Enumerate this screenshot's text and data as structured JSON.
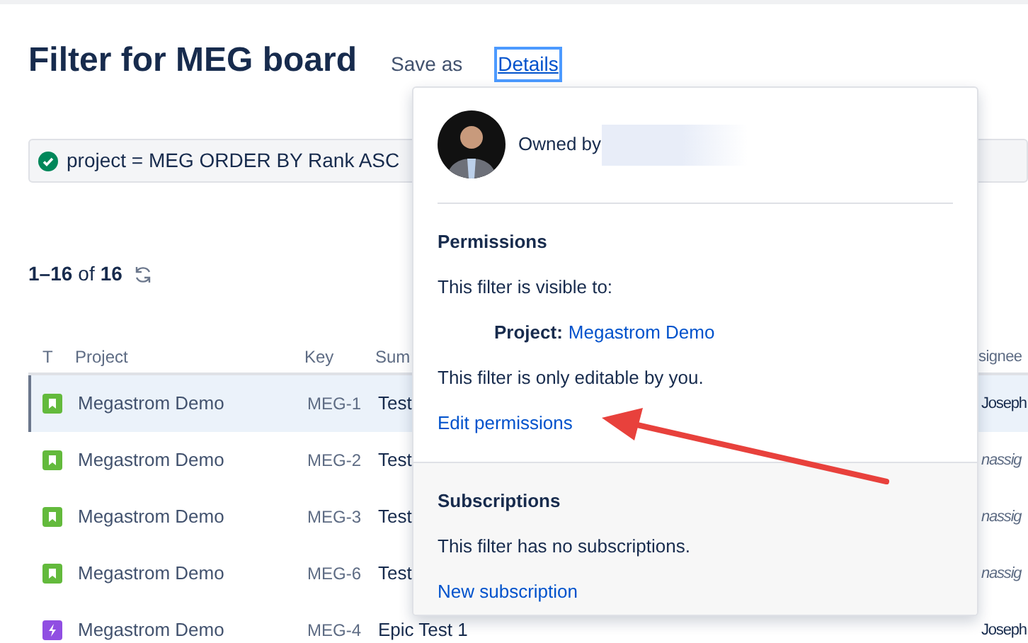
{
  "header": {
    "title": "Filter for MEG board",
    "save_as": "Save as",
    "details": {
      "label": "Details",
      "selected": true
    }
  },
  "query": {
    "text": "project = MEG ORDER BY Rank ASC",
    "valid": true
  },
  "count": {
    "range": "1–16",
    "of": "of",
    "total": "16"
  },
  "table": {
    "columns": [
      "T",
      "Project",
      "Key",
      "Sum",
      "signee"
    ],
    "rows": [
      {
        "kind": "story",
        "project": "Megastrom Demo",
        "key": "MEG-1",
        "summary": "Test",
        "assignee": "Joseph",
        "unassigned": false,
        "selected": true
      },
      {
        "kind": "story",
        "project": "Megastrom Demo",
        "key": "MEG-2",
        "summary": "Test",
        "assignee": "nassig",
        "unassigned": true,
        "selected": false
      },
      {
        "kind": "story",
        "project": "Megastrom Demo",
        "key": "MEG-3",
        "summary": "Test",
        "assignee": "nassig",
        "unassigned": true,
        "selected": false
      },
      {
        "kind": "story",
        "project": "Megastrom Demo",
        "key": "MEG-6",
        "summary": "Test",
        "assignee": "nassig",
        "unassigned": true,
        "selected": false
      },
      {
        "kind": "epic",
        "project": "Megastrom Demo",
        "key": "MEG-4",
        "summary": "Epic Test 1",
        "assignee": "Joseph",
        "unassigned": false,
        "selected": false
      }
    ]
  },
  "popup": {
    "owner": "Owned by",
    "permissions": {
      "heading": "Permissions",
      "visible_to": "This filter is visible to:",
      "share_label": "Project:",
      "share_value": "Megastrom Demo",
      "editable": "This filter is only editable by you.",
      "edit_link": "Edit permissions"
    },
    "subscriptions": {
      "heading": "Subscriptions",
      "status": "This filter has no subscriptions.",
      "new_link": "New subscription"
    }
  }
}
